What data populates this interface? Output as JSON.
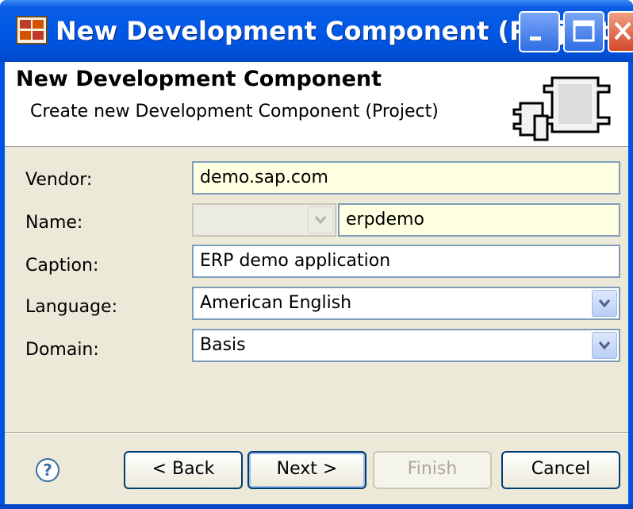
{
  "window": {
    "title": "New Development Component (Project)",
    "controls": [
      "minimize",
      "maximize",
      "close"
    ]
  },
  "banner": {
    "title": "New Development Component",
    "description": "Create new Development Component (Project)"
  },
  "form": {
    "vendor": {
      "label": "Vendor:",
      "value": "demo.sap.com"
    },
    "name": {
      "label": "Name:",
      "prefix_value": "",
      "value": "erpdemo"
    },
    "caption": {
      "label": "Caption:",
      "value": "ERP demo application"
    },
    "language": {
      "label": "Language:",
      "value": "American English"
    },
    "domain": {
      "label": "Domain:",
      "value": "Basis"
    }
  },
  "buttons": {
    "back": "< Back",
    "next": "Next >",
    "finish": "Finish",
    "cancel": "Cancel"
  },
  "colors": {
    "titlebar": "#0058e6",
    "required_field": "#ffffe1",
    "dialog_bg": "#ece9d8"
  }
}
